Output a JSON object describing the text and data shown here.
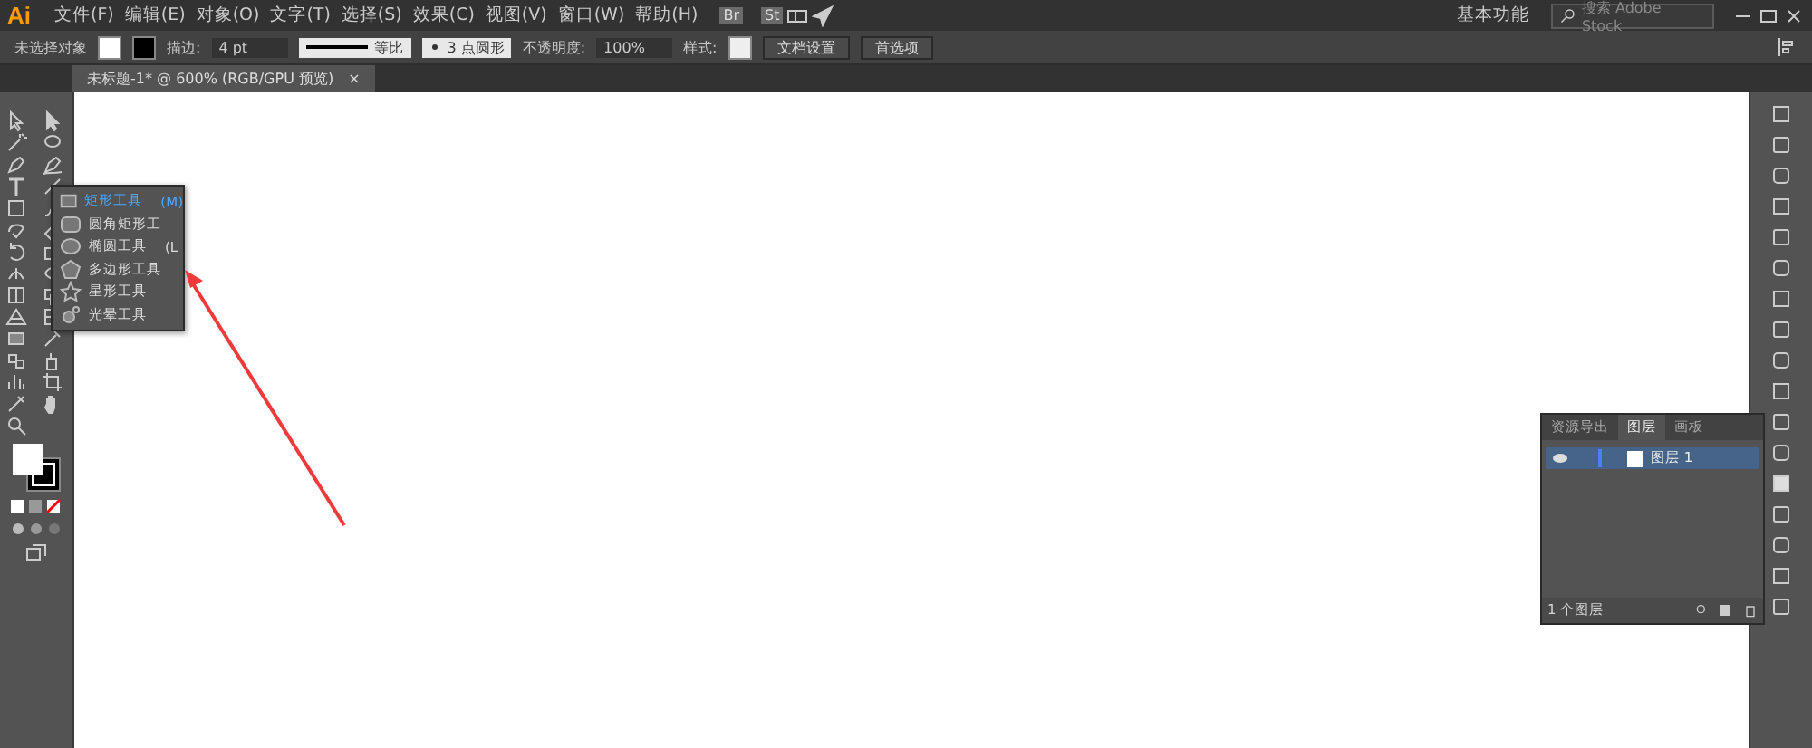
{
  "app": {
    "logo": "Ai",
    "menu": [
      "文件(F)",
      "编辑(E)",
      "对象(O)",
      "文字(T)",
      "选择(S)",
      "效果(C)",
      "视图(V)",
      "窗口(W)",
      "帮助(H)"
    ],
    "bridge": "Br",
    "stock": "St",
    "workspace": "基本功能",
    "search": {
      "placeholder": "搜索 Adobe Stock"
    }
  },
  "control_bar": {
    "selection": "未选择对象",
    "stroke_label": "描边:",
    "stroke_weight": "4 pt",
    "stroke_profile": "等比",
    "brush": "3 点圆形",
    "opacity_label": "不透明度:",
    "opacity": "100%",
    "style_label": "样式:",
    "buttons": [
      "文档设置",
      "首选项"
    ]
  },
  "document_tab": {
    "title": "未标题-1* @ 600% (RGB/GPU 预览)",
    "close": "×"
  },
  "flyout": [
    {
      "label": "矩形工具",
      "shortcut": "(M)",
      "kind": "rect",
      "selected": true
    },
    {
      "label": "圆角矩形工",
      "kind": "rounded",
      "selected": false
    },
    {
      "label": "椭圆工具",
      "shortcut": "(L",
      "kind": "ellipse",
      "selected": false
    },
    {
      "label": "多边形工具",
      "kind": "polygon",
      "selected": false
    },
    {
      "label": "星形工具",
      "kind": "star",
      "selected": false
    },
    {
      "label": "光晕工具",
      "kind": "flare",
      "selected": false
    }
  ],
  "layers_panel": {
    "tabs": [
      {
        "label": "资源导出",
        "selected": false
      },
      {
        "label": "图层",
        "selected": true
      },
      {
        "label": "画板",
        "selected": false
      }
    ],
    "layers": [
      {
        "name": "图层 1",
        "visible": true
      }
    ],
    "footer": "1 个图层"
  }
}
